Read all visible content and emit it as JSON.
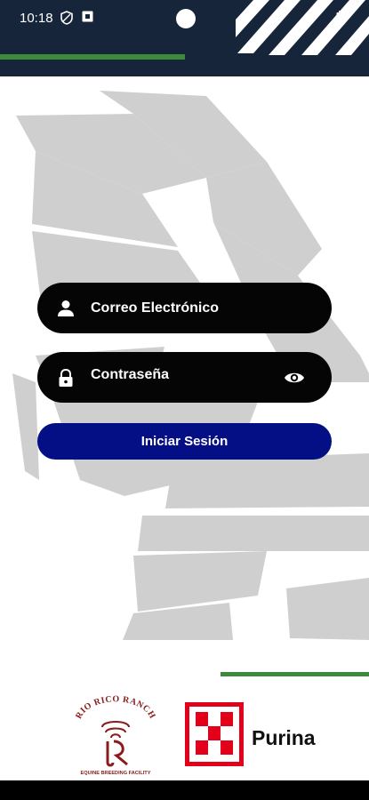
{
  "status": {
    "time": "10:18",
    "icons": [
      "shield-icon",
      "notification-icon",
      "wifi-icon",
      "battery-icon"
    ]
  },
  "form": {
    "email_label": "Correo Electrónico",
    "password_label": "Contraseña",
    "login_label": "Iniciar Sesión"
  },
  "logos": {
    "rio_name": "RIO RICO RANCH",
    "rio_subtitle": "EQUINE BREEDING FACILITY",
    "purina": "Purina"
  },
  "colors": {
    "status_bar": "#16253a",
    "field_bg": "#050505",
    "primary_button": "#040f86",
    "accent_green": "#3c8a3a",
    "background_art": "#cfcfcf",
    "brand_red": "#e2001a",
    "rio_red": "#8b1b1b"
  }
}
